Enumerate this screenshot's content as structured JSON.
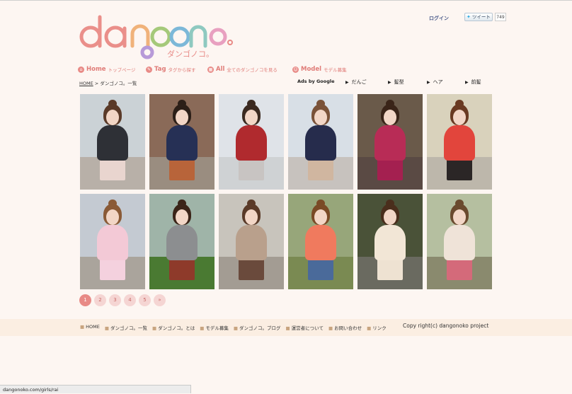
{
  "header": {
    "logo_main": "dangonoko",
    "logo_sub": "ダンゴノコ。",
    "login": "ログイン",
    "tweet_label": "ツイート",
    "tweet_count": "749"
  },
  "nav": [
    {
      "title": "Home",
      "sub": "トップページ",
      "icon": "home-icon"
    },
    {
      "title": "Tag",
      "sub": "タグから探す",
      "icon": "tag-icon"
    },
    {
      "title": "All",
      "sub": "全てのダンゴノコを見る",
      "icon": "all-icon"
    },
    {
      "title": "Model",
      "sub": "モデル募集",
      "icon": "model-icon"
    }
  ],
  "breadcrumb": {
    "home": "HOME",
    "separator": " > ",
    "current": "ダンゴノコ。一覧"
  },
  "ads": {
    "label": "Ads by Google",
    "links": [
      "だんご",
      "髪型",
      "ヘア",
      "前髪"
    ]
  },
  "gallery": [
    {
      "bg": "#cbd2d6",
      "ground": "#b8b0a8",
      "hair": "#5a3a28",
      "top": "#2e3036",
      "skirt": "#e9d5cf"
    },
    {
      "bg": "#8a6a58",
      "ground": "#9a8d80",
      "hair": "#2c1f18",
      "top": "#263055",
      "skirt": "#b8643a"
    },
    {
      "bg": "#dfe3e8",
      "ground": "#cfd2d4",
      "hair": "#3b2a20",
      "top": "#b02a2e",
      "skirt": "#c8c4c2"
    },
    {
      "bg": "#d8dfe6",
      "ground": "#c7c2be",
      "hair": "#7a5238",
      "top": "#262c4c",
      "skirt": "#d0b6a0"
    },
    {
      "bg": "#6a5a4a",
      "ground": "#5a4a44",
      "hair": "#3a2418",
      "top": "#b82c56",
      "skirt": "#a42050"
    },
    {
      "bg": "#d9d2bc",
      "ground": "#bdb7ab",
      "hair": "#6a3a22",
      "top": "#e2453c",
      "skirt": "#2b2626"
    },
    {
      "bg": "#c4cad2",
      "ground": "#aaa49c",
      "hair": "#8a5a36",
      "top": "#f3c9d6",
      "skirt": "#f4d1de"
    },
    {
      "bg": "#9fb4a8",
      "ground": "#4a7a32",
      "hair": "#3b2418",
      "top": "#8c8e90",
      "skirt": "#8e3a2a"
    },
    {
      "bg": "#c8c4bc",
      "ground": "#a39c93",
      "hair": "#5a3a28",
      "top": "#b9a08c",
      "skirt": "#6a4a3c"
    },
    {
      "bg": "#97a67a",
      "ground": "#7a8a52",
      "hair": "#7a4a26",
      "top": "#f07a5e",
      "skirt": "#4a6a9a"
    },
    {
      "bg": "#4a5238",
      "ground": "#6a6a60",
      "hair": "#4a2e1c",
      "top": "#f2e6d6",
      "skirt": "#eee2d2"
    },
    {
      "bg": "#b5bfa0",
      "ground": "#8a8a6e",
      "hair": "#6a4a2e",
      "top": "#efe3d8",
      "skirt": "#d46a7a"
    }
  ],
  "pagination": [
    "1",
    "2",
    "3",
    "4",
    "5",
    "»"
  ],
  "footer": {
    "links": [
      "HOME",
      "ダンゴノコ。一覧",
      "ダンゴノコ。とは",
      "モデル募集",
      "ダンゴノコ。ブログ",
      "運営者について",
      "お問い合わせ",
      "リンク"
    ],
    "copyright": "Copy right(c) dangonoko project"
  },
  "status_url": "dangonoko.com/girls/rai",
  "colors": {
    "accent": "#e07c78",
    "background": "#fdf6f2",
    "footer_bg": "#fbeee2"
  }
}
